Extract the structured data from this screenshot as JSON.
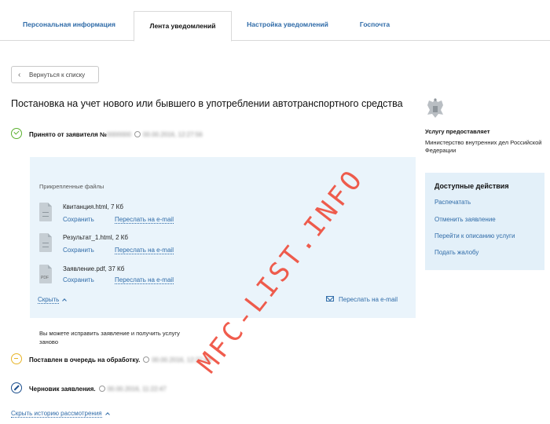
{
  "tabs": [
    {
      "label": "Персональная информация"
    },
    {
      "label": "Лента уведомлений"
    },
    {
      "label": "Настройка уведомлений"
    },
    {
      "label": "Госпочта"
    }
  ],
  "back_button": {
    "label": "Вернуться к списку"
  },
  "page_title": "Постановка на учет нового или бывшего в употреблении автотранспортного средства",
  "statuses": [
    {
      "label": "Принято от заявителя №",
      "number": "0000000",
      "datetime": "00.00.2016, 12:27:56",
      "state": "accepted",
      "color": "#5ab02e"
    },
    {
      "label": "Поставлен в очередь на обработку.",
      "datetime": "00.00.2016, 12:27:46",
      "state": "queued",
      "color": "#e8b427"
    },
    {
      "label": "Черновик заявления.",
      "datetime": "00.00.2016, 11:22:47",
      "state": "draft",
      "color": "#1a4d8c"
    }
  ],
  "files_panel": {
    "caption": "Прикрепленные файлы",
    "files": [
      {
        "name": "Квитанция.html, 7 Кб",
        "save_label": "Сохранить",
        "mail_label": "Переслать на e-mail",
        "icon": "document-icon"
      },
      {
        "name": "Результат_1.html, 2 Кб",
        "save_label": "Сохранить",
        "mail_label": "Переслать на e-mail",
        "icon": "document-icon"
      },
      {
        "name": "Заявление.pdf, 37 Кб",
        "save_label": "Сохранить",
        "mail_label": "Переслать на e-mail",
        "icon": "pdf-icon"
      }
    ],
    "hide_label": "Скрыть",
    "mail_all_label": "Переслать на e-mail"
  },
  "fix_note": "Вы можете исправить заявление и получить услугу заново",
  "history_link": "Скрыть историю рассмотрения",
  "sidebar": {
    "provider_title": "Услугу предоставляет",
    "provider_name": "Министерство внутренних дел Российской Федерации",
    "actions_title": "Доступные действия",
    "actions": [
      {
        "label": "Распечатать"
      },
      {
        "label": "Отменить заявление"
      },
      {
        "label": "Перейти к описанию услуги"
      },
      {
        "label": "Подать жалобу"
      }
    ]
  },
  "watermark": "MFC-LIST.INFO",
  "colors": {
    "link": "#2f6ba8",
    "panel": "#eaf4fb",
    "actions_bg": "#e3f0f9",
    "watermark": "#ef4b3a"
  }
}
